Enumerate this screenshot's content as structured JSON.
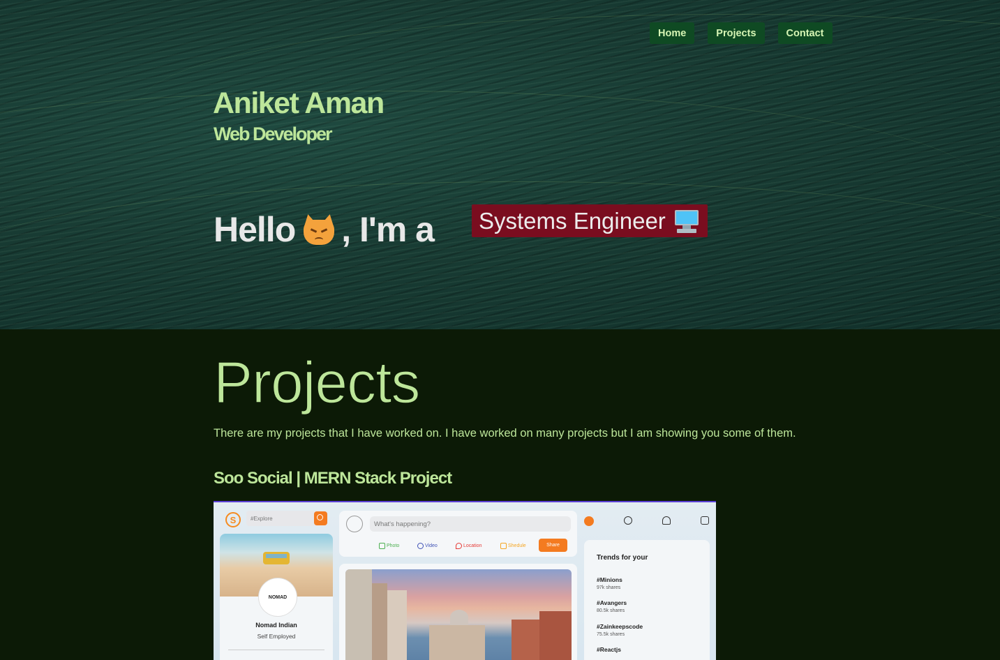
{
  "nav": {
    "home": "Home",
    "projects": "Projects",
    "contact": "Contact"
  },
  "hero": {
    "name": "Aniket Aman",
    "role": "Web Developer",
    "hello": "Hello",
    "im_a": ", I'm a",
    "typed_role": "Systems Engineer",
    "hello_emoji": "angry-cat-icon",
    "typed_emoji": "desktop-computer-icon"
  },
  "projects": {
    "title": "Projects",
    "description": "There are my projects that I have worked on. I have worked on many projects but I am showing you some of them.",
    "items": [
      {
        "title": "Soo Social | MERN Stack Project",
        "screenshot": {
          "search_placeholder": "#Explore",
          "profile_name": "Nomad Indian",
          "profile_job": "Self Employed",
          "avatar_text": "NOMAD",
          "composer_placeholder": "What's happening?",
          "post_options": [
            "Photo",
            "Video",
            "Location",
            "Shedule"
          ],
          "share_label": "Share",
          "trends_title": "Trends for your",
          "trends": [
            {
              "tag": "#Minions",
              "shares": "97k shares"
            },
            {
              "tag": "#Avangers",
              "shares": "80.5k shares"
            },
            {
              "tag": "#Zainkeepscode",
              "shares": "75.5k shares"
            },
            {
              "tag": "#Reactjs",
              "shares": ""
            }
          ]
        }
      }
    ]
  },
  "colors": {
    "accent_text": "#bde69a",
    "nav_bg": "#0f4a23",
    "typed_bg": "#7a0d1f",
    "section_bg": "#0c1a06"
  }
}
